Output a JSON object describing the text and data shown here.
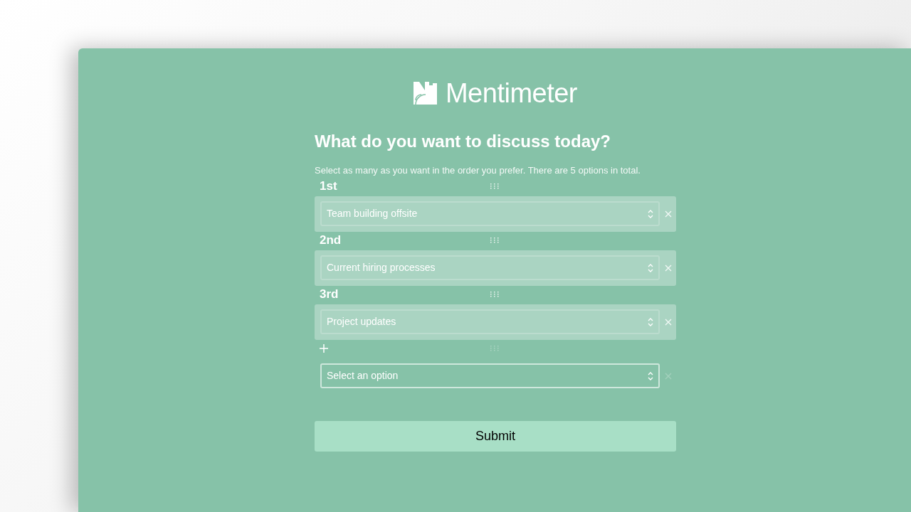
{
  "logo": {
    "text": "Mentimeter"
  },
  "question": {
    "title": "What do you want to discuss today?",
    "instructions": "Select as many as you want in the order you prefer. There are 5 options in total."
  },
  "ranks": [
    {
      "kind": "filled",
      "label": "1st",
      "value": "Team building offsite"
    },
    {
      "kind": "filled",
      "label": "2nd",
      "value": "Current hiring processes"
    },
    {
      "kind": "filled",
      "label": "3rd",
      "value": "Project updates"
    },
    {
      "kind": "empty",
      "placeholder": "Select an option"
    }
  ],
  "submit": {
    "label": "Submit"
  }
}
